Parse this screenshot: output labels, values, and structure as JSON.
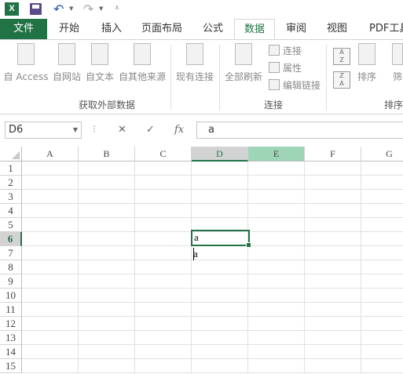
{
  "quick_access": {
    "app_icon_text": "X",
    "app_icon_color": "#217346"
  },
  "tabs": {
    "file": "文件",
    "items": [
      "开始",
      "插入",
      "页面布局",
      "公式",
      "数据",
      "审阅",
      "视图",
      "PDF工具"
    ],
    "active": "数据"
  },
  "ribbon": {
    "get_external": {
      "buttons": [
        "自 Access",
        "自网站",
        "自文本",
        "自其他来源"
      ],
      "label": "获取外部数据"
    },
    "existing_conn": "现有连接",
    "connections": {
      "refresh_all": "全部刷新",
      "conn": "连接",
      "props": "属性",
      "edit_links": "编辑链接",
      "label": "连接"
    },
    "sort": {
      "sort_label": "排序",
      "group_label": "排序",
      "filter_partial": "筛"
    }
  },
  "formula_bar": {
    "name_box": "D6",
    "cancel": "✕",
    "enter": "✓",
    "fx": "fx",
    "content": "a"
  },
  "sheet": {
    "columns": [
      "A",
      "B",
      "C",
      "D",
      "E",
      "F",
      "G"
    ],
    "rows": [
      "1",
      "2",
      "3",
      "4",
      "5",
      "6",
      "7",
      "8",
      "9",
      "10",
      "11",
      "12",
      "13",
      "14",
      "15"
    ],
    "selected_col": "D",
    "selected_row": "6",
    "d6": "a",
    "d7": "a"
  },
  "colors": {
    "accent": "#217346",
    "selected_header_bg": "#d3d3d3",
    "adjacent_header_bg": "#9fd5b7"
  }
}
